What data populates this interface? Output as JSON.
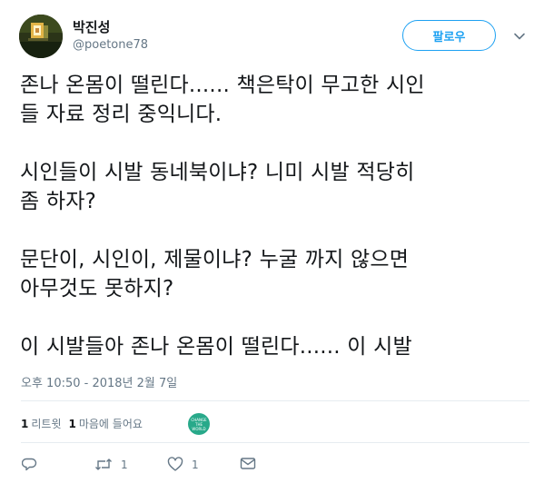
{
  "author": {
    "display_name": "박진성",
    "handle": "@poetone78",
    "avatar_icon": "avatar-image"
  },
  "follow_button": {
    "label": "팔로우"
  },
  "menu_icon": "chevron-down-icon",
  "tweet": {
    "paragraphs": [
      [
        "존나 온몸이 떨린다...... 책은탁이 무고한 시인",
        "들 자료 정리 중익니다."
      ],
      [
        "시인들이 시발 동네북이냐? 니미 시발 적당히",
        "좀 하자?"
      ],
      [
        "문단이, 시인이, 제물이냐? 누굴 까지 않으면",
        "아무것도 못하지?"
      ],
      [
        "이 시발들아 존나 온몸이 떨린다...... 이 시발"
      ]
    ],
    "timestamp": "오후 10:50 - 2018년 2월 7일"
  },
  "stats": {
    "retweets_count": "1",
    "retweets_label": "리트윗",
    "likes_count": "1",
    "likes_label": "마음에 들어요",
    "liker_avatar_text": "CHANGE THE WORLD"
  },
  "actions": {
    "reply": {
      "icon": "reply-icon",
      "count": ""
    },
    "retweet": {
      "icon": "retweet-icon",
      "count": "1"
    },
    "like": {
      "icon": "heart-icon",
      "count": "1"
    },
    "message": {
      "icon": "envelope-icon",
      "count": ""
    }
  },
  "colors": {
    "accent": "#1da1f2",
    "text": "#14171a",
    "secondary_text": "#657786",
    "divider": "#e6ecf0"
  }
}
